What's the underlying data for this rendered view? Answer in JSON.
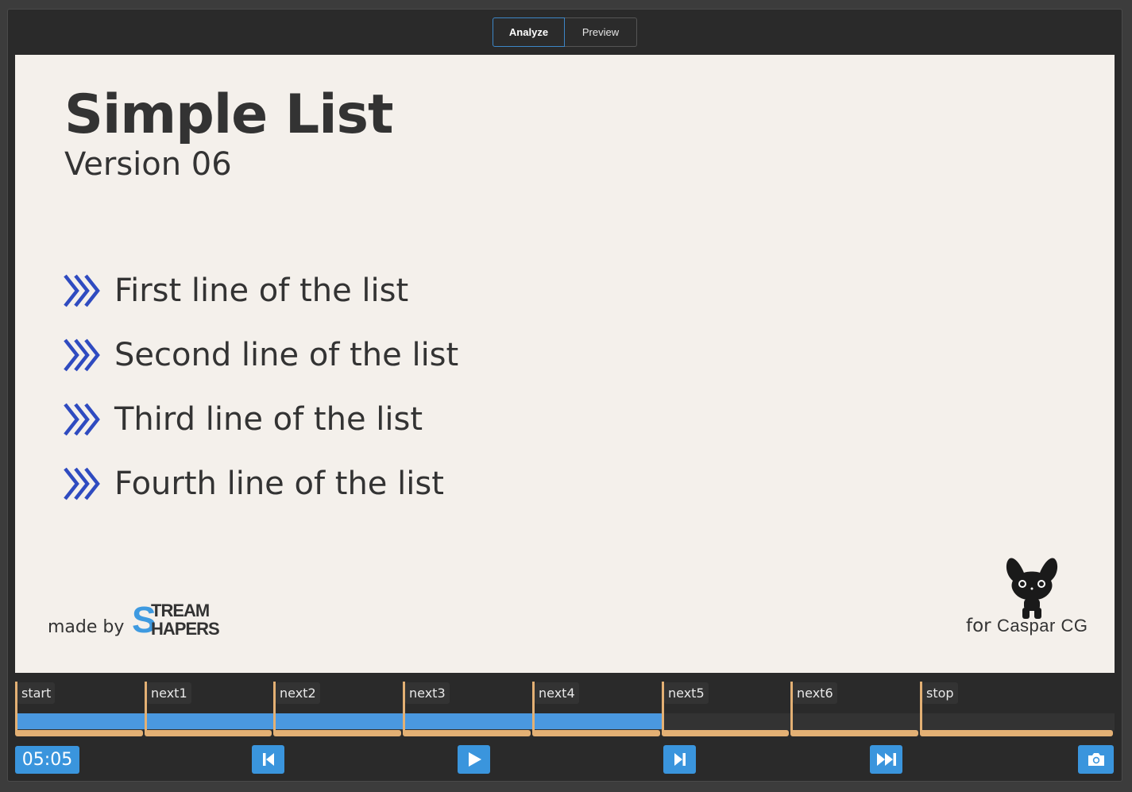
{
  "tabs": [
    {
      "label": "Analyze",
      "active": true
    },
    {
      "label": "Preview",
      "active": false
    }
  ],
  "slide": {
    "title": "Simple List",
    "subtitle": "Version 06",
    "items": [
      "First line of the list",
      "Second line of the list",
      "Third line of the list",
      "Fourth line of the list"
    ],
    "made_by": "made by",
    "logo_text": [
      "STREAM",
      "SHAPERS"
    ],
    "for_label": "for",
    "caspar_label": "Caspar CG",
    "bullet_color": "#2f4bc0",
    "logo_color": "#3e9ae0"
  },
  "timeline": {
    "markers": [
      "start",
      "next1",
      "next2",
      "next3",
      "next4",
      "next5",
      "next6",
      "stop"
    ],
    "active_markers": 5,
    "progress_color": "#4a98e0",
    "segment_color": "#e3b074"
  },
  "controls": {
    "time": "05:05",
    "buttons": [
      "skip-back-icon",
      "play-icon",
      "step-next-icon",
      "fast-forward-icon",
      "camera-icon"
    ],
    "accent": "#3a95dd"
  }
}
